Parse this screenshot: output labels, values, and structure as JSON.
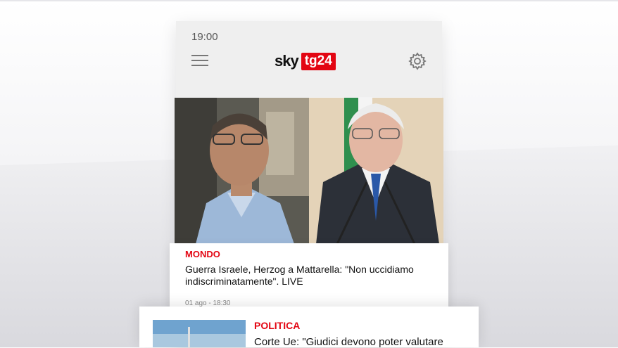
{
  "status_bar": {
    "time": "19:00"
  },
  "header": {
    "logo_text_1": "sky",
    "logo_text_2": "tg24",
    "menu_icon": "hamburger-menu-icon",
    "settings_icon": "gear-icon"
  },
  "articles": [
    {
      "category": "MONDO",
      "title": "Guerra Israele, Herzog a Mattarella: \"Non uccidiamo indiscriminatamente\". LIVE",
      "date": "01 ago - 18:30"
    },
    {
      "category": "POLITICA",
      "title": "Corte Ue: \"Giudici devono poter valutare"
    }
  ],
  "colors": {
    "brand_red": "#e30613"
  }
}
